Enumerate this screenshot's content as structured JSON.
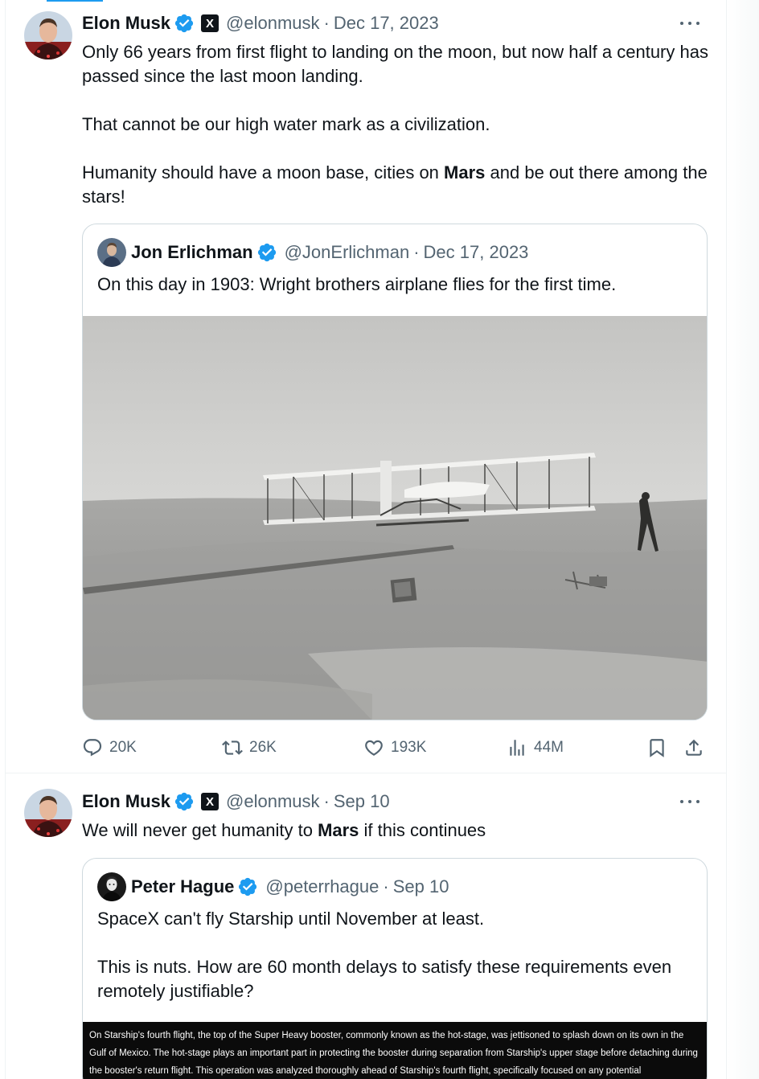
{
  "colors": {
    "accent": "#1d9bf0",
    "text_primary": "#0f1419",
    "text_secondary": "#536471",
    "border": "#cfd9de",
    "verified": "#1d9bf0"
  },
  "tweets": [
    {
      "author": {
        "name": "Elon Musk",
        "handle": "@elonmusk",
        "verified": true,
        "affiliate_badge": "X"
      },
      "separator": "·",
      "date": "Dec 17, 2023",
      "more_icon": "ellipsis-icon",
      "text_segments": [
        {
          "text": "Only 66 years from first flight to landing on the moon, but now half a century has passed since the last moon landing.\n\nThat cannot be our high water mark as a civilization.\n\nHumanity should have a moon base, cities on ",
          "bold": false
        },
        {
          "text": "Mars",
          "bold": true
        },
        {
          "text": " and be out there among the stars!",
          "bold": false
        }
      ],
      "quote": {
        "author": {
          "name": "Jon Erlichman",
          "handle": "@JonErlichman",
          "verified": true
        },
        "separator": "·",
        "date": "Dec 17, 2023",
        "text": "On this day in 1903: Wright brothers airplane flies for the first time.",
        "media": "wright-flyer-photo"
      },
      "actions": {
        "reply": {
          "icon": "reply-icon",
          "count": "20K"
        },
        "retweet": {
          "icon": "retweet-icon",
          "count": "26K"
        },
        "like": {
          "icon": "heart-icon",
          "count": "193K"
        },
        "views": {
          "icon": "views-icon",
          "count": "44M"
        },
        "bookmark": {
          "icon": "bookmark-icon"
        },
        "share": {
          "icon": "share-icon"
        }
      }
    },
    {
      "author": {
        "name": "Elon Musk",
        "handle": "@elonmusk",
        "verified": true,
        "affiliate_badge": "X"
      },
      "separator": "·",
      "date": "Sep 10",
      "more_icon": "ellipsis-icon",
      "text_segments": [
        {
          "text": "We will never get humanity to ",
          "bold": false
        },
        {
          "text": "Mars",
          "bold": true
        },
        {
          "text": " if this continues",
          "bold": false
        }
      ],
      "quote": {
        "author": {
          "name": "Peter Hague",
          "handle": "@peterrhague",
          "verified": true
        },
        "separator": "·",
        "date": "Sep 10",
        "text": "SpaceX can't fly Starship until November at least.\n\nThis is nuts. How are 60 month delays to satisfy these requirements even remotely justifiable?",
        "media_text": "On Starship's fourth flight, the top of the Super Heavy booster, commonly known as the hot-stage, was jettisoned to splash down on its own in the Gulf of Mexico. The hot-stage plays an important part in protecting the booster during separation from Starship's upper stage before detaching during the booster's return flight. This operation was analyzed thoroughly ahead of Starship's fourth flight, specifically focused on any potential"
      }
    }
  ]
}
